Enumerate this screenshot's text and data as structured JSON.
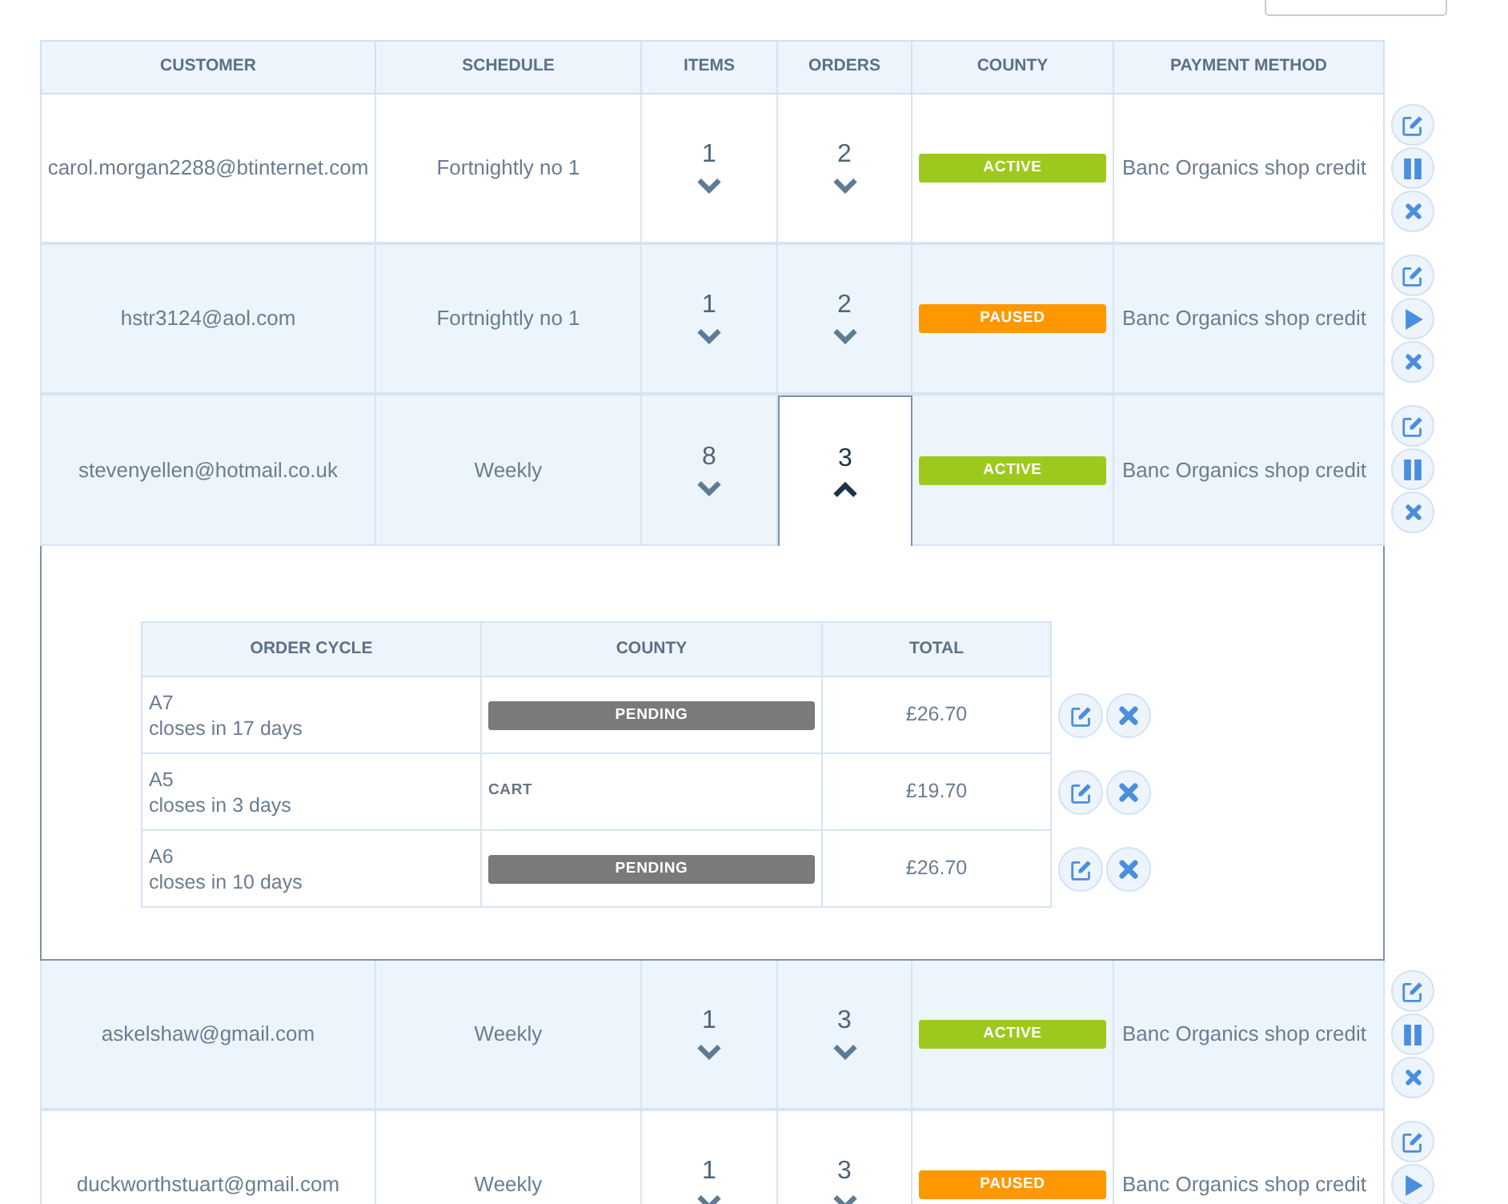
{
  "table": {
    "columns": [
      "CUSTOMER",
      "SCHEDULE",
      "ITEMS",
      "ORDERS",
      "COUNTY",
      "PAYMENT METHOD"
    ],
    "rows": [
      {
        "customer": "carol.morgan2288@btinternet.com",
        "schedule": "Fortnightly no 1",
        "items": {
          "count": "1",
          "expanded": false
        },
        "orders": {
          "count": "2",
          "expanded": false
        },
        "status": {
          "kind": "badge",
          "label": "ACTIVE",
          "color": "#9dc91f"
        },
        "payment_method": "Banc Organics shop credit",
        "highlighted": false,
        "actions": [
          {
            "kind": "edit"
          },
          {
            "kind": "pause"
          },
          {
            "kind": "cancel"
          }
        ]
      },
      {
        "customer": "hstr3124@aol.com",
        "schedule": "Fortnightly no 1",
        "items": {
          "count": "1",
          "expanded": false
        },
        "orders": {
          "count": "2",
          "expanded": false
        },
        "status": {
          "kind": "badge",
          "label": "PAUSED",
          "color": "#ff9800"
        },
        "payment_method": "Banc Organics shop credit",
        "highlighted": true,
        "actions": [
          {
            "kind": "edit"
          },
          {
            "kind": "resume"
          },
          {
            "kind": "cancel"
          }
        ]
      },
      {
        "customer": "stevenyellen@hotmail.co.uk",
        "schedule": "Weekly",
        "items": {
          "count": "8",
          "expanded": false
        },
        "orders": {
          "count": "3",
          "expanded": true
        },
        "status": {
          "kind": "badge",
          "label": "ACTIVE",
          "color": "#9dc91f"
        },
        "payment_method": "Banc Organics shop credit",
        "highlighted": true,
        "actions": [
          {
            "kind": "edit"
          },
          {
            "kind": "pause"
          },
          {
            "kind": "cancel"
          }
        ],
        "detail": {
          "columns": [
            "ORDER CYCLE",
            "COUNTY",
            "TOTAL"
          ],
          "rows": [
            {
              "order_cycle": "A7",
              "closing": "closes in 17 days",
              "county": {
                "kind": "badge",
                "label": "PENDING",
                "color": "#7a7a7a"
              },
              "total": "£26.70",
              "actions": [
                {
                  "kind": "edit"
                },
                {
                  "kind": "cancel"
                }
              ]
            },
            {
              "order_cycle": "A5",
              "closing": "closes in 3 days",
              "county": {
                "kind": "plain",
                "label": "CART"
              },
              "total": "£19.70",
              "actions": [
                {
                  "kind": "edit"
                },
                {
                  "kind": "cancel"
                }
              ]
            },
            {
              "order_cycle": "A6",
              "closing": "closes in 10 days",
              "county": {
                "kind": "badge",
                "label": "PENDING",
                "color": "#7a7a7a"
              },
              "total": "£26.70",
              "actions": [
                {
                  "kind": "edit"
                },
                {
                  "kind": "cancel"
                }
              ]
            }
          ]
        }
      },
      {
        "customer": "askelshaw@gmail.com",
        "schedule": "Weekly",
        "items": {
          "count": "1",
          "expanded": false
        },
        "orders": {
          "count": "3",
          "expanded": false
        },
        "status": {
          "kind": "badge",
          "label": "ACTIVE",
          "color": "#9dc91f"
        },
        "payment_method": "Banc Organics shop credit",
        "highlighted": true,
        "actions": [
          {
            "kind": "edit"
          },
          {
            "kind": "pause"
          },
          {
            "kind": "cancel"
          }
        ]
      },
      {
        "customer": "duckworthstuart@gmail.com",
        "schedule": "Weekly",
        "items": {
          "count": "1",
          "expanded": false
        },
        "orders": {
          "count": "3",
          "expanded": false
        },
        "status": {
          "kind": "badge",
          "label": "PAUSED",
          "color": "#ff9800"
        },
        "payment_method": "Banc Organics shop credit",
        "highlighted": false,
        "actions": [
          {
            "kind": "edit"
          },
          {
            "kind": "resume"
          }
        ]
      }
    ]
  }
}
